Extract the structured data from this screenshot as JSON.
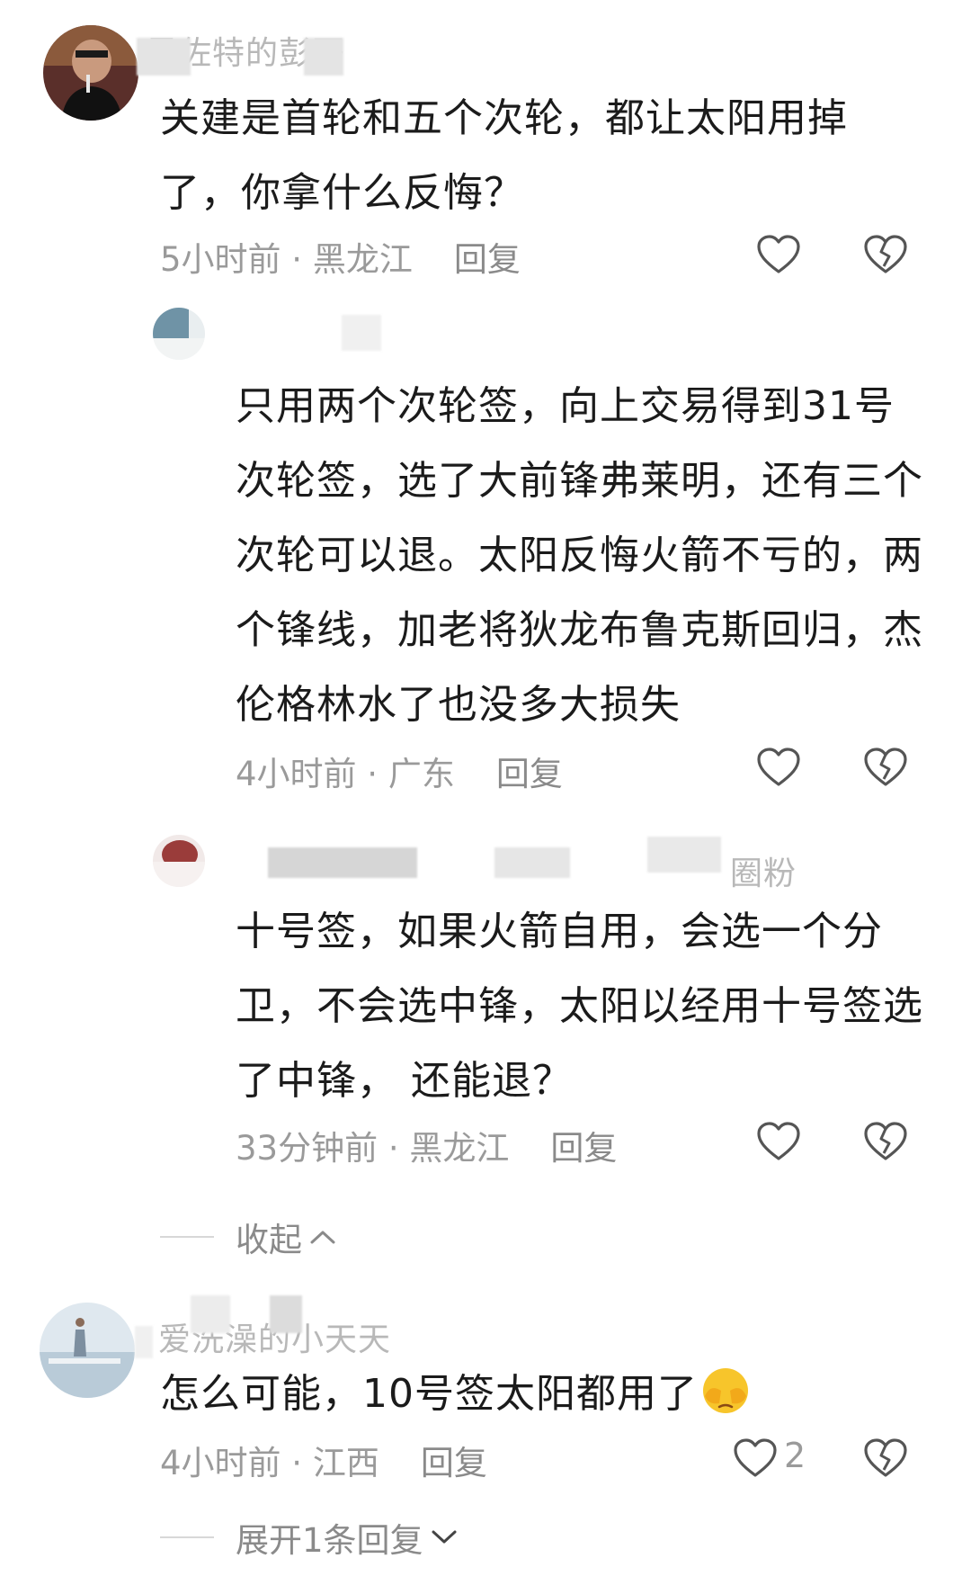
{
  "comments": [
    {
      "username": "黑佐特的彭哥",
      "text_lines": [
        "关建是首轮和五个次轮，都让太阳用掉",
        "了，你拿什么反悔？"
      ],
      "time": "5小时前",
      "location": "黑龙江",
      "reply_label": "回复"
    },
    {
      "text_lines": [
        "只用两个次轮签，向上交易得到31号",
        "次轮签，选了大前锋弗莱明，还有三个",
        "次轮可以退。太阳反悔火箭不亏的，两",
        "个锋线，加老将狄龙布鲁克斯回归，杰",
        "伦格林水了也没多大损失"
      ],
      "time": "4小时前",
      "location": "广东",
      "reply_label": "回复"
    },
    {
      "username_suffix": "圈粉",
      "text_lines": [
        "十号签，如果火箭自用，会选一个分",
        "卫，不会选中锋，太阳以经用十号签选",
        "了中锋， 还能退？"
      ],
      "time": "33分钟前",
      "location": "黑龙江",
      "reply_label": "回复"
    },
    {
      "username": "爱洗澡的小天天",
      "text": "怎么可能，10号签太阳都用了",
      "time": "4小时前",
      "location": "江西",
      "reply_label": "回复",
      "like_count": "2"
    }
  ],
  "collapse_label": "收起",
  "expand_label": "展开1条回复",
  "meta_separator": " · ",
  "icons": {
    "like": "heart-outline-icon",
    "dislike": "broken-heart-icon",
    "collapse": "chevron-up-icon",
    "expand": "chevron-down-icon",
    "emoji": "face-covering-eyes-emoji"
  }
}
